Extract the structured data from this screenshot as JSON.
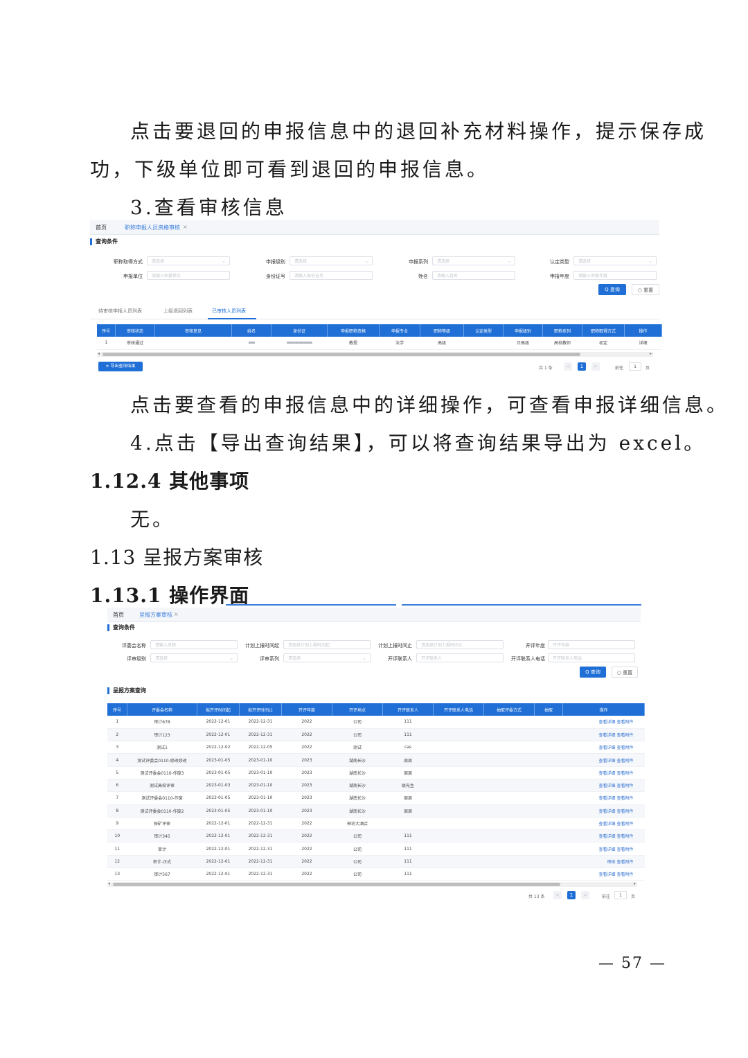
{
  "doc": {
    "para1_line1": "点击要退回的申报信息中的退回补充材料操作，提示保存成",
    "para1_line2": "功，下级单位即可看到退回的申报信息。",
    "step3": "3.查看审核信息",
    "para2": "点击要查看的申报信息中的详细操作，可查看申报详细信息。",
    "step4": "4.点击【导出查询结果】，可以将查询结果导出为 excel。",
    "h_1124": "1.12.4 其他事项",
    "none_text": "无。",
    "h_113": "1.13 呈报方案审核",
    "h_1131": "1.13.1 操作界面",
    "page_number": "— 57 —"
  },
  "shot1": {
    "crumb_home": "首页",
    "crumb_page": "职称申报人员资格审核",
    "crumb_close": "×",
    "section_title": "查询条件",
    "fields": [
      {
        "label": "职称取得方式",
        "placeholder": "请选择",
        "dropdown": true
      },
      {
        "label": "申报级别",
        "placeholder": "请选择",
        "dropdown": true
      },
      {
        "label": "申报系列",
        "placeholder": "请选择",
        "dropdown": true
      },
      {
        "label": "认定类型",
        "placeholder": "请选择",
        "dropdown": true
      },
      {
        "label": "申报单位",
        "placeholder": "请输入申报单位",
        "dropdown": false
      },
      {
        "label": "身份证号",
        "placeholder": "请输入身份证号",
        "dropdown": false
      },
      {
        "label": "姓名",
        "placeholder": "请输入姓名",
        "dropdown": false
      },
      {
        "label": "申报年度",
        "placeholder": "请输入申报年度",
        "dropdown": false
      }
    ],
    "query_btn": "Q 查询",
    "reset_btn": "○ 重置",
    "tabs": [
      "待审核申报人员列表",
      "上级退回列表",
      "已审核人员列表"
    ],
    "columns": [
      "序号",
      "审核状态",
      "审核意见",
      "姓名",
      "身份证",
      "申报职称资格",
      "申报专业",
      "职称等级",
      "认定类型",
      "申报级别",
      "职称系列",
      "职称取得方式",
      "操作"
    ],
    "rows": [
      [
        "1",
        "审核通过",
        "",
        "",
        "",
        "教授",
        "法学",
        "高级",
        "",
        "正高级",
        "高校教师",
        "初定",
        "详细"
      ]
    ],
    "export_btn": "± 导出查询结果",
    "total": "共 1 条",
    "page_current": "1",
    "goto_label": "前往",
    "goto_value": "1",
    "page_unit": "页",
    "prev": "<",
    "next": ">"
  },
  "shot2": {
    "crumb_home": "首页",
    "crumb_page": "呈报方案审核",
    "crumb_close": "×",
    "section_title": "查询条件",
    "fields": [
      {
        "label": "评委会名称",
        "placeholder": "请输入名称",
        "dropdown": false
      },
      {
        "label": "计划上报时间起",
        "placeholder": "请选择计划上报时间起",
        "dropdown": false
      },
      {
        "label": "计划上报时间止",
        "placeholder": "请选择计划上报时间止",
        "dropdown": false
      },
      {
        "label": "开评年度",
        "placeholder": "开评年度",
        "dropdown": false
      },
      {
        "label": "评审级别",
        "placeholder": "请选择",
        "dropdown": true
      },
      {
        "label": "评审系列",
        "placeholder": "请选择",
        "dropdown": true
      },
      {
        "label": "开评联系人",
        "placeholder": "开评联系人",
        "dropdown": false
      },
      {
        "label": "开评联系人电话",
        "placeholder": "开评联系人电话",
        "dropdown": false
      }
    ],
    "query_btn": "Q 查询",
    "reset_btn": "○ 重置",
    "list_title": "呈报方案查询",
    "columns": [
      "序号",
      "评委会名称",
      "拟开评时间起",
      "拟开评时间止",
      "开评年度",
      "开评地点",
      "开评联系人",
      "开评联系人电话",
      "抽取评委方式",
      "抽取",
      "操作"
    ],
    "rows": [
      [
        "1",
        "审计678",
        "2022-12-01",
        "2022-12-31",
        "2022",
        "公司",
        "111",
        "",
        "",
        "",
        "查看详细",
        "查看附件"
      ],
      [
        "2",
        "审计123",
        "2022-12-01",
        "2022-12-31",
        "2022",
        "公司",
        "111",
        "",
        "",
        "",
        "查看详细",
        "查看附件"
      ],
      [
        "3",
        "测试1",
        "2022-12-02",
        "2022-12-05",
        "2022",
        "测试",
        "cas",
        "",
        "",
        "",
        "查看详细",
        "查看附件"
      ],
      [
        "4",
        "测试评委会0110-修改修改",
        "2023-01-05",
        "2023-01-10",
        "2023",
        "湖南长沙",
        "周周",
        "",
        "",
        "",
        "查看详细",
        "查看附件"
      ],
      [
        "5",
        "测试评委会0110-作废3",
        "2023-01-05",
        "2023-01-10",
        "2023",
        "湖南长沙",
        "周周",
        "",
        "",
        "",
        "查看详细",
        "查看附件"
      ],
      [
        "6",
        "测试高校评审",
        "2023-01-03",
        "2023-01-10",
        "2023",
        "湖南长沙",
        "联先生",
        "",
        "",
        "",
        "查看详细",
        "查看附件"
      ],
      [
        "7",
        "测试评委会0110-作废",
        "2023-01-05",
        "2023-01-10",
        "2023",
        "湖南长沙",
        "周周",
        "",
        "",
        "",
        "查看详细",
        "查看附件"
      ],
      [
        "8",
        "测试评委会0110-作废2",
        "2023-01-05",
        "2023-01-10",
        "2023",
        "湖南长沙",
        "周周",
        "",
        "",
        "",
        "查看详细",
        "查看附件"
      ],
      [
        "9",
        "探矿评审",
        "2022-12-01",
        "2022-12-31",
        "2022",
        "神农大酒店",
        "",
        "",
        "",
        "",
        "查看详细",
        "查看附件"
      ],
      [
        "10",
        "审计345",
        "2022-12-01",
        "2022-12-31",
        "2022",
        "公司",
        "111",
        "",
        "",
        "",
        "查看详细",
        "查看附件"
      ],
      [
        "11",
        "审计",
        "2022-12-01",
        "2022-12-31",
        "2022",
        "公司",
        "111",
        "",
        "",
        "",
        "查看详细",
        "查看附件"
      ],
      [
        "12",
        "审计-正式",
        "2022-12-01",
        "2022-12-31",
        "2022",
        "公司",
        "111",
        "",
        "",
        "",
        "审核",
        "查看附件"
      ],
      [
        "13",
        "审计567",
        "2022-12-01",
        "2022-12-31",
        "2022",
        "公司",
        "111",
        "",
        "",
        "",
        "查看详细",
        "查看附件"
      ]
    ],
    "total": "共 13 条",
    "page_current": "1",
    "goto_label": "前往",
    "goto_value": "1",
    "page_unit": "页",
    "prev": "<",
    "next": ">"
  },
  "colors": {
    "primary": "#1f6fd6",
    "link": "#2f6fd0"
  }
}
